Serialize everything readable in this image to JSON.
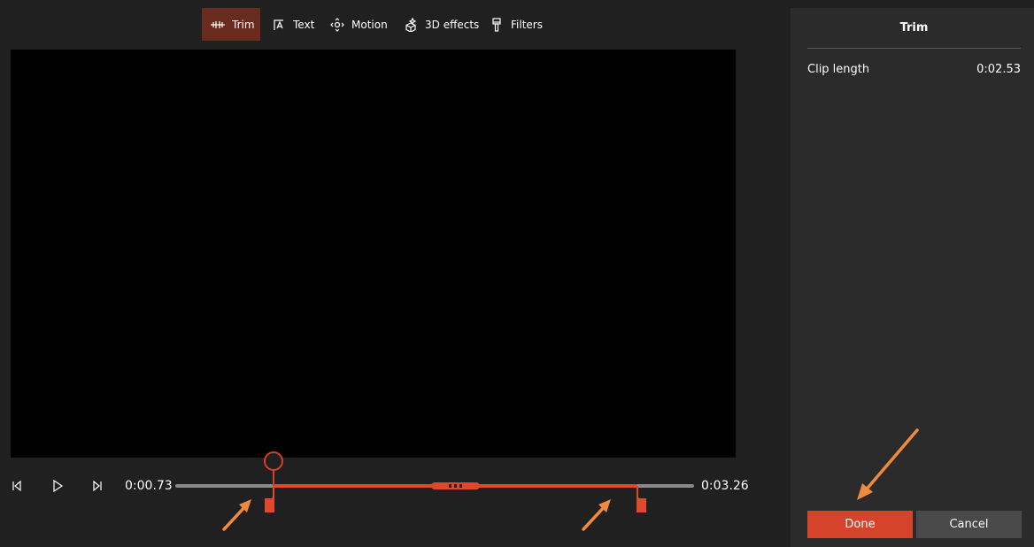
{
  "toolbar": {
    "items": [
      {
        "label": "Trim",
        "icon": "trim-icon",
        "active": true
      },
      {
        "label": "Text",
        "icon": "text-icon",
        "active": false
      },
      {
        "label": "Motion",
        "icon": "motion-icon",
        "active": false
      },
      {
        "label": "3D effects",
        "icon": "3d-effects-icon",
        "active": false
      },
      {
        "label": "Filters",
        "icon": "filters-icon",
        "active": false
      }
    ]
  },
  "timeline": {
    "start_time": "0:00.73",
    "end_time": "0:03.26",
    "selection_start_fraction": 0.19,
    "selection_end_fraction": 0.89,
    "playhead_fraction": 0.19
  },
  "panel": {
    "title": "Trim",
    "clip_length_label": "Clip length",
    "clip_length_value": "0:02.53",
    "done_label": "Done",
    "cancel_label": "Cancel"
  },
  "colors": {
    "accent": "#d4432a",
    "active_tool": "#6a2b1f",
    "annotation_arrow": "#f08a3c",
    "background": "#202020",
    "panel": "#2b2b2b"
  }
}
